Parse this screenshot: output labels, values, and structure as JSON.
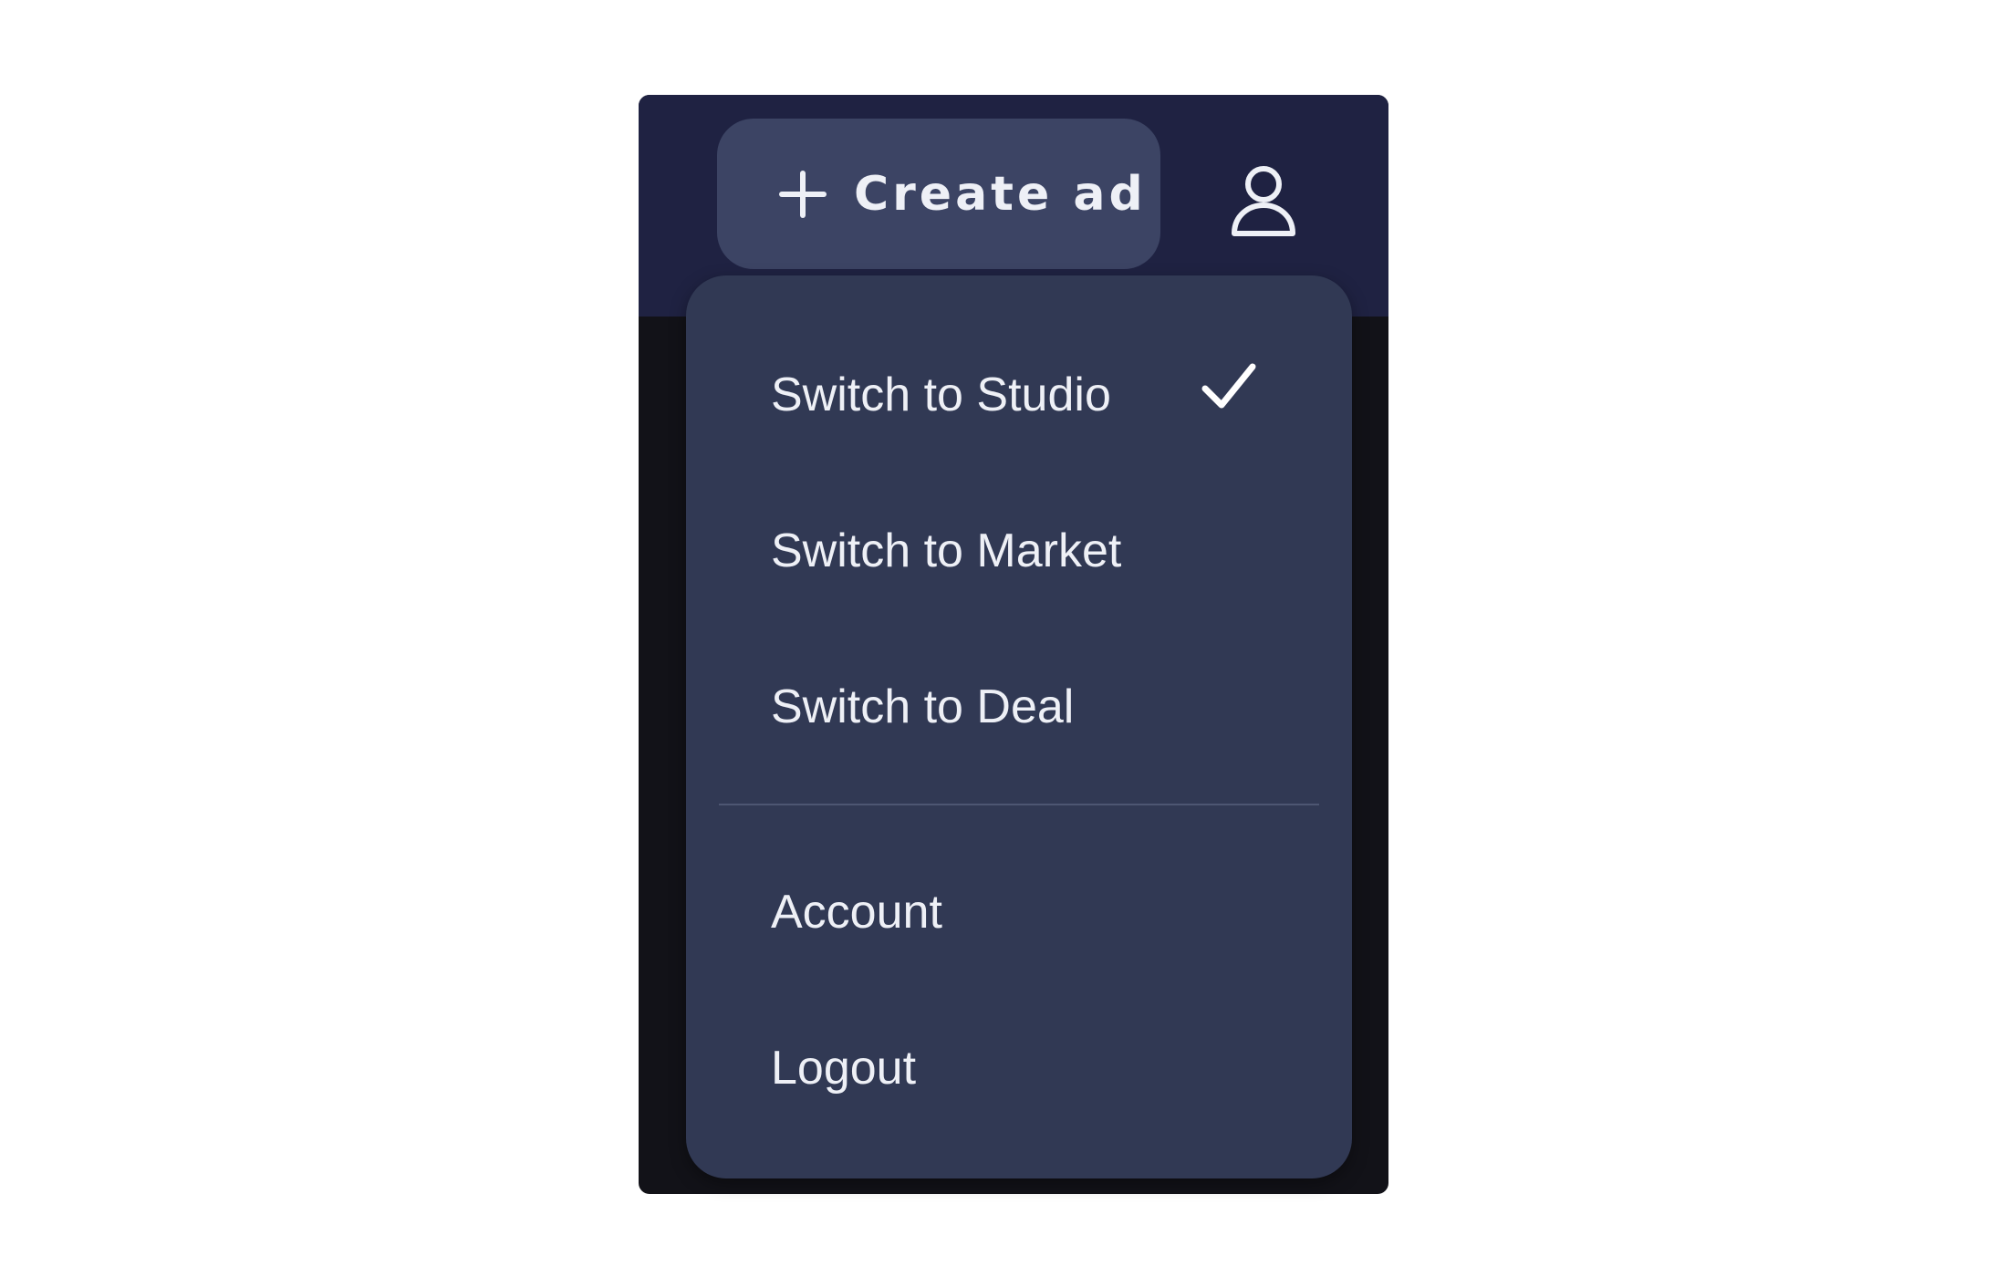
{
  "header": {
    "create_ad_label": "Create ad"
  },
  "menu": {
    "items": [
      {
        "label": "Switch to Studio",
        "selected": true
      },
      {
        "label": "Switch to Market",
        "selected": false
      },
      {
        "label": "Switch to Deal",
        "selected": false
      }
    ],
    "account_items": [
      {
        "label": "Account"
      },
      {
        "label": "Logout"
      }
    ]
  },
  "icons": {
    "create": "plus-icon",
    "profile": "user-icon",
    "selected": "check-icon"
  },
  "colors": {
    "header_bg": "#1f2242",
    "button_bg": "#3c4464",
    "menu_bg": "#313954",
    "text": "#eef0f6"
  }
}
